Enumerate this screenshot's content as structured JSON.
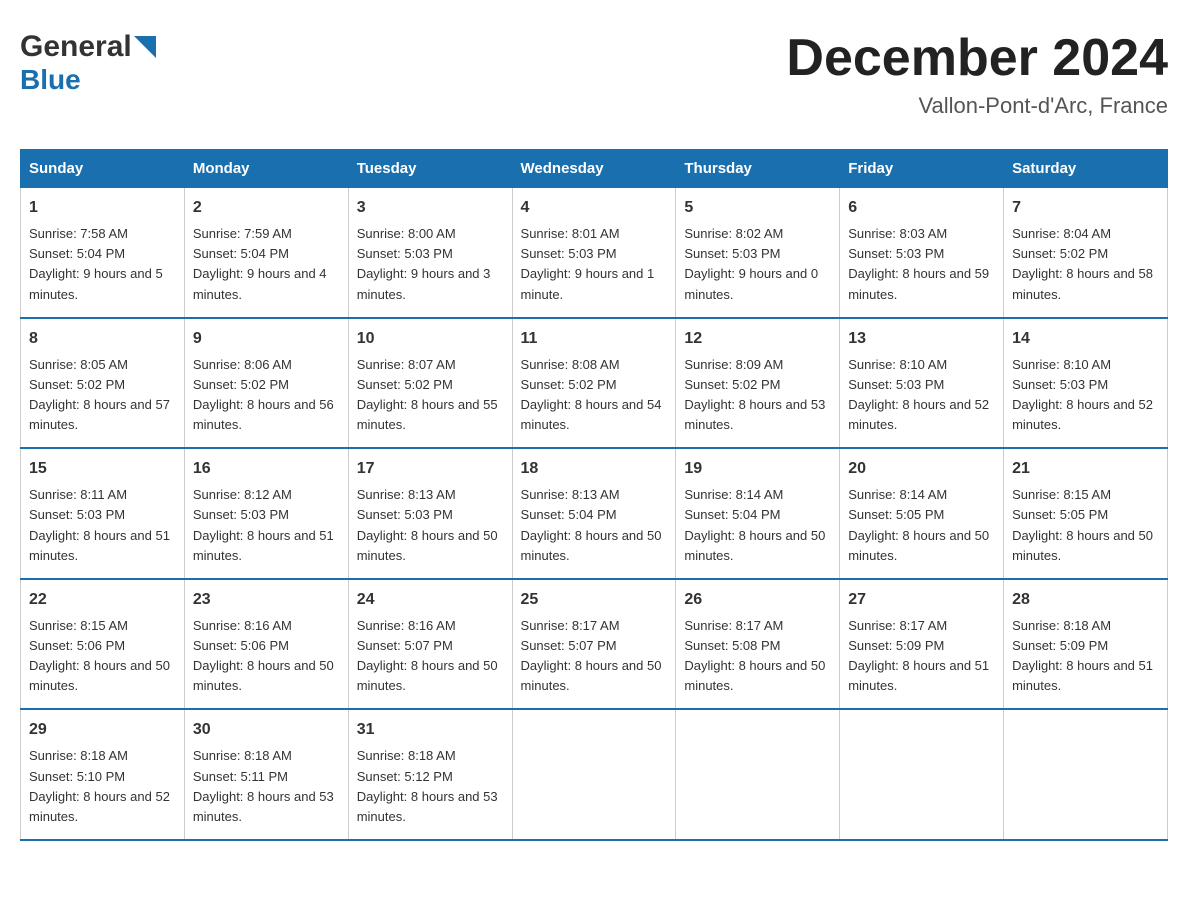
{
  "header": {
    "logo_general": "General",
    "logo_blue": "Blue",
    "month": "December 2024",
    "location": "Vallon-Pont-d'Arc, France"
  },
  "days_header": [
    "Sunday",
    "Monday",
    "Tuesday",
    "Wednesday",
    "Thursday",
    "Friday",
    "Saturday"
  ],
  "weeks": [
    [
      {
        "day": "1",
        "sunrise": "7:58 AM",
        "sunset": "5:04 PM",
        "daylight": "9 hours and 5 minutes."
      },
      {
        "day": "2",
        "sunrise": "7:59 AM",
        "sunset": "5:04 PM",
        "daylight": "9 hours and 4 minutes."
      },
      {
        "day": "3",
        "sunrise": "8:00 AM",
        "sunset": "5:03 PM",
        "daylight": "9 hours and 3 minutes."
      },
      {
        "day": "4",
        "sunrise": "8:01 AM",
        "sunset": "5:03 PM",
        "daylight": "9 hours and 1 minute."
      },
      {
        "day": "5",
        "sunrise": "8:02 AM",
        "sunset": "5:03 PM",
        "daylight": "9 hours and 0 minutes."
      },
      {
        "day": "6",
        "sunrise": "8:03 AM",
        "sunset": "5:03 PM",
        "daylight": "8 hours and 59 minutes."
      },
      {
        "day": "7",
        "sunrise": "8:04 AM",
        "sunset": "5:02 PM",
        "daylight": "8 hours and 58 minutes."
      }
    ],
    [
      {
        "day": "8",
        "sunrise": "8:05 AM",
        "sunset": "5:02 PM",
        "daylight": "8 hours and 57 minutes."
      },
      {
        "day": "9",
        "sunrise": "8:06 AM",
        "sunset": "5:02 PM",
        "daylight": "8 hours and 56 minutes."
      },
      {
        "day": "10",
        "sunrise": "8:07 AM",
        "sunset": "5:02 PM",
        "daylight": "8 hours and 55 minutes."
      },
      {
        "day": "11",
        "sunrise": "8:08 AM",
        "sunset": "5:02 PM",
        "daylight": "8 hours and 54 minutes."
      },
      {
        "day": "12",
        "sunrise": "8:09 AM",
        "sunset": "5:02 PM",
        "daylight": "8 hours and 53 minutes."
      },
      {
        "day": "13",
        "sunrise": "8:10 AM",
        "sunset": "5:03 PM",
        "daylight": "8 hours and 52 minutes."
      },
      {
        "day": "14",
        "sunrise": "8:10 AM",
        "sunset": "5:03 PM",
        "daylight": "8 hours and 52 minutes."
      }
    ],
    [
      {
        "day": "15",
        "sunrise": "8:11 AM",
        "sunset": "5:03 PM",
        "daylight": "8 hours and 51 minutes."
      },
      {
        "day": "16",
        "sunrise": "8:12 AM",
        "sunset": "5:03 PM",
        "daylight": "8 hours and 51 minutes."
      },
      {
        "day": "17",
        "sunrise": "8:13 AM",
        "sunset": "5:03 PM",
        "daylight": "8 hours and 50 minutes."
      },
      {
        "day": "18",
        "sunrise": "8:13 AM",
        "sunset": "5:04 PM",
        "daylight": "8 hours and 50 minutes."
      },
      {
        "day": "19",
        "sunrise": "8:14 AM",
        "sunset": "5:04 PM",
        "daylight": "8 hours and 50 minutes."
      },
      {
        "day": "20",
        "sunrise": "8:14 AM",
        "sunset": "5:05 PM",
        "daylight": "8 hours and 50 minutes."
      },
      {
        "day": "21",
        "sunrise": "8:15 AM",
        "sunset": "5:05 PM",
        "daylight": "8 hours and 50 minutes."
      }
    ],
    [
      {
        "day": "22",
        "sunrise": "8:15 AM",
        "sunset": "5:06 PM",
        "daylight": "8 hours and 50 minutes."
      },
      {
        "day": "23",
        "sunrise": "8:16 AM",
        "sunset": "5:06 PM",
        "daylight": "8 hours and 50 minutes."
      },
      {
        "day": "24",
        "sunrise": "8:16 AM",
        "sunset": "5:07 PM",
        "daylight": "8 hours and 50 minutes."
      },
      {
        "day": "25",
        "sunrise": "8:17 AM",
        "sunset": "5:07 PM",
        "daylight": "8 hours and 50 minutes."
      },
      {
        "day": "26",
        "sunrise": "8:17 AM",
        "sunset": "5:08 PM",
        "daylight": "8 hours and 50 minutes."
      },
      {
        "day": "27",
        "sunrise": "8:17 AM",
        "sunset": "5:09 PM",
        "daylight": "8 hours and 51 minutes."
      },
      {
        "day": "28",
        "sunrise": "8:18 AM",
        "sunset": "5:09 PM",
        "daylight": "8 hours and 51 minutes."
      }
    ],
    [
      {
        "day": "29",
        "sunrise": "8:18 AM",
        "sunset": "5:10 PM",
        "daylight": "8 hours and 52 minutes."
      },
      {
        "day": "30",
        "sunrise": "8:18 AM",
        "sunset": "5:11 PM",
        "daylight": "8 hours and 53 minutes."
      },
      {
        "day": "31",
        "sunrise": "8:18 AM",
        "sunset": "5:12 PM",
        "daylight": "8 hours and 53 minutes."
      },
      {
        "day": "",
        "sunrise": "",
        "sunset": "",
        "daylight": ""
      },
      {
        "day": "",
        "sunrise": "",
        "sunset": "",
        "daylight": ""
      },
      {
        "day": "",
        "sunrise": "",
        "sunset": "",
        "daylight": ""
      },
      {
        "day": "",
        "sunrise": "",
        "sunset": "",
        "daylight": ""
      }
    ]
  ],
  "labels": {
    "sunrise_prefix": "Sunrise: ",
    "sunset_prefix": "Sunset: ",
    "daylight_prefix": "Daylight: "
  }
}
